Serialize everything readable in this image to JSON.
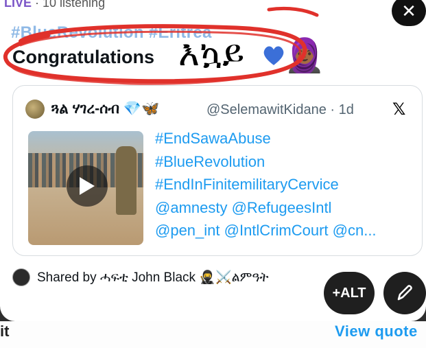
{
  "header": {
    "live_label": "LIVE",
    "listening_text": " · 10 listening",
    "close_symbol": "✕"
  },
  "post": {
    "hashtag_line": "#BlueRevolution #Eritrea",
    "congrats_text": "Congratulations",
    "handwritten_overlay": "እኳይ",
    "heart_color": "#3b6fd8",
    "annotation_color": "#e0312b"
  },
  "quote": {
    "author_name": "ጓል ሃገረ-ሰብ 💎🦋",
    "author_handle": "@SelemawitKidane · 1d",
    "platform_logo": "𝕏",
    "lines": [
      "#EndSawaAbuse",
      "#BlueRevolution",
      "#EndInFinitemilitaryCervice",
      "@amnesty @RefugeesIntl",
      "@pen_int @IntlCrimCourt @cn..."
    ]
  },
  "footer": {
    "shared_text": "Shared by ሓፍቲ John Black 🥷⚔️ልምዓት",
    "alt_label": "+ALT"
  },
  "underlay": {
    "left_text": "it",
    "right_text": "View quote"
  },
  "colors": {
    "link_blue": "#1d9bf0",
    "live_purple": "#7b55c7"
  }
}
